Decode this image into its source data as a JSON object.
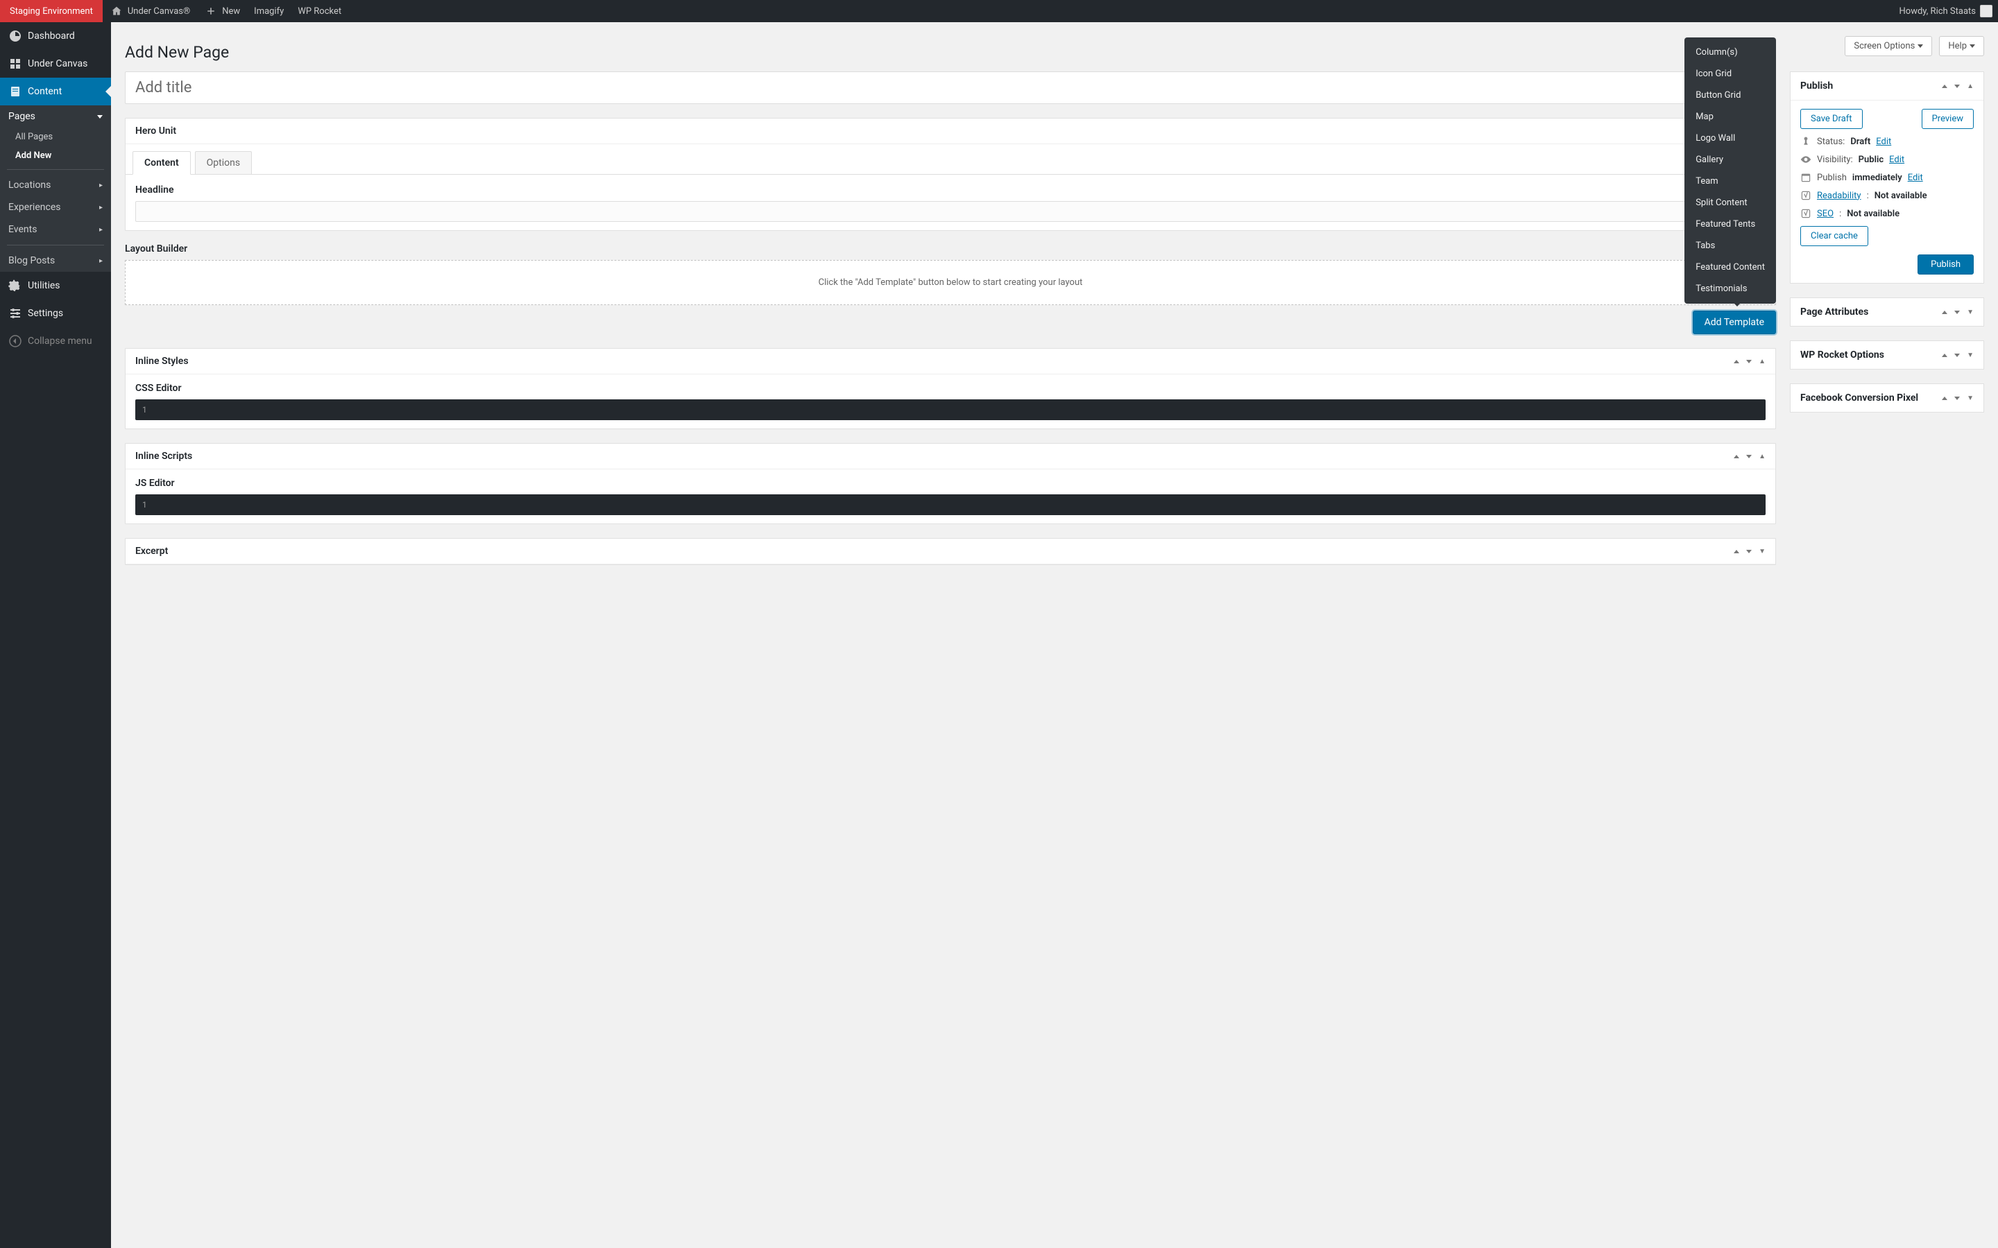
{
  "adminBar": {
    "staging": "Staging Environment",
    "siteName": "Under Canvas®",
    "new": "New",
    "imagify": "Imagify",
    "wpRocket": "WP Rocket",
    "howdy": "Howdy, Rich Staats"
  },
  "sidebar": {
    "dashboard": "Dashboard",
    "underCanvas": "Under Canvas",
    "content": "Content",
    "pages": "Pages",
    "allPages": "All Pages",
    "addNew": "Add New",
    "locations": "Locations",
    "experiences": "Experiences",
    "events": "Events",
    "blogPosts": "Blog Posts",
    "utilities": "Utilities",
    "settings": "Settings",
    "collapse": "Collapse menu"
  },
  "topButtons": {
    "screenOptions": "Screen Options",
    "help": "Help"
  },
  "pageHeading": "Add New Page",
  "titlePlaceholder": "Add title",
  "heroUnit": {
    "boxTitle": "Hero Unit",
    "tabContent": "Content",
    "tabOptions": "Options",
    "headlineLabel": "Headline",
    "headlineValue": ""
  },
  "layoutBuilder": {
    "title": "Layout Builder",
    "emptyText": "Click the \"Add Template\" button below to start creating your layout",
    "addTemplate": "Add Template",
    "templates": [
      "Column(s)",
      "Icon Grid",
      "Button Grid",
      "Map",
      "Logo Wall",
      "Gallery",
      "Team",
      "Split Content",
      "Featured Tents",
      "Tabs",
      "Featured Content",
      "Testimonials"
    ]
  },
  "inlineStyles": {
    "boxTitle": "Inline Styles",
    "label": "CSS Editor",
    "line": "1"
  },
  "inlineScripts": {
    "boxTitle": "Inline Scripts",
    "label": "JS Editor",
    "line": "1"
  },
  "excerpt": {
    "boxTitle": "Excerpt"
  },
  "publish": {
    "boxTitle": "Publish",
    "saveDraft": "Save Draft",
    "preview": "Preview",
    "statusLabel": "Status:",
    "statusValue": "Draft",
    "visibilityLabel": "Visibility:",
    "visibilityValue": "Public",
    "publishLabel": "Publish",
    "publishValue": "immediately",
    "edit": "Edit",
    "readability": "Readability",
    "seo": "SEO",
    "notAvailable": "Not available",
    "clearCache": "Clear cache",
    "publishBtn": "Publish"
  },
  "sideBoxes": {
    "pageAttributes": "Page Attributes",
    "wpRocketOptions": "WP Rocket Options",
    "fbPixel": "Facebook Conversion Pixel"
  }
}
